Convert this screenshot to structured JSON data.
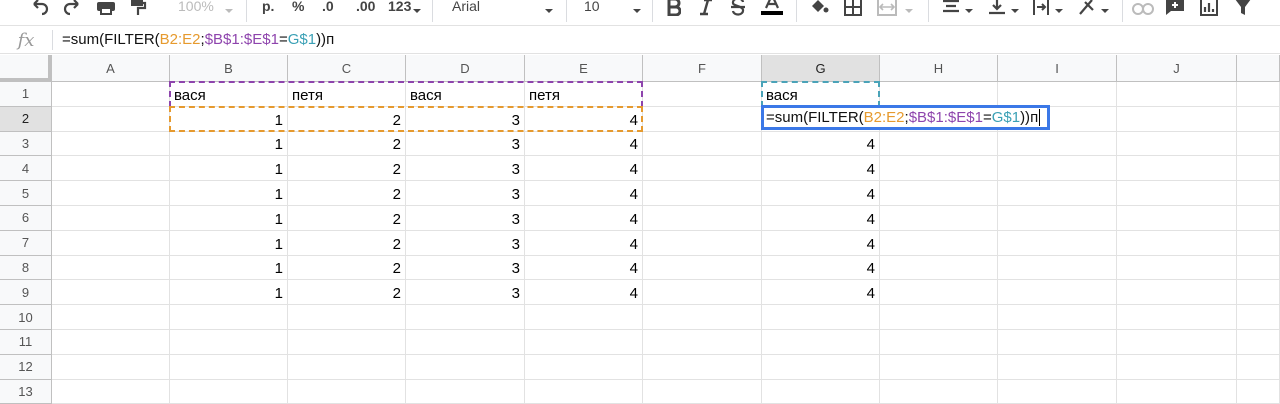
{
  "toolbar": {
    "zoom": "100%",
    "currency_label": "р.",
    "percent_label": "%",
    "decimal_decrease_label": ".0",
    "decimal_increase_label": ".00",
    "format_more_label": "123",
    "font_name": "Arial",
    "font_size": "10"
  },
  "formula_bar": {
    "fx_label": "fx",
    "parts": [
      {
        "text": "=sum(FILTER(",
        "color": "default"
      },
      {
        "text": "B2:E2",
        "color": "orange"
      },
      {
        "text": ";",
        "color": "default"
      },
      {
        "text": "$B$1:$E$1",
        "color": "purple"
      },
      {
        "text": "=",
        "color": "default"
      },
      {
        "text": "G$1",
        "color": "teal"
      },
      {
        "text": "))",
        "color": "default"
      },
      {
        "text": "п",
        "color": "default"
      }
    ]
  },
  "columns": [
    "A",
    "B",
    "C",
    "D",
    "E",
    "F",
    "G",
    "H",
    "I",
    "J"
  ],
  "rows": [
    "1",
    "2",
    "3",
    "4",
    "5",
    "6",
    "7",
    "8",
    "9",
    "10",
    "11",
    "12",
    "13"
  ],
  "selected": {
    "column": "G",
    "row": "2"
  },
  "cells": {
    "B1": "вася",
    "C1": "петя",
    "D1": "вася",
    "E1": "петя",
    "G1": "вася",
    "B2": "1",
    "C2": "2",
    "D2": "3",
    "E2": "4",
    "B3": "1",
    "C3": "2",
    "D3": "3",
    "E3": "4",
    "G3": "4",
    "B4": "1",
    "C4": "2",
    "D4": "3",
    "E4": "4",
    "G4": "4",
    "B5": "1",
    "C5": "2",
    "D5": "3",
    "E5": "4",
    "G5": "4",
    "B6": "1",
    "C6": "2",
    "D6": "3",
    "E6": "4",
    "G6": "4",
    "B7": "1",
    "C7": "2",
    "D7": "3",
    "E7": "4",
    "G7": "4",
    "B8": "1",
    "C8": "2",
    "D8": "3",
    "E8": "4",
    "G8": "4",
    "B9": "1",
    "C9": "2",
    "D9": "3",
    "E9": "4",
    "G9": "4"
  },
  "colors": {
    "range_orange": "#e69a2e",
    "range_purple": "#8e44ad",
    "range_teal": "#3aa0b5",
    "active_cell_border": "#3b78e7"
  }
}
